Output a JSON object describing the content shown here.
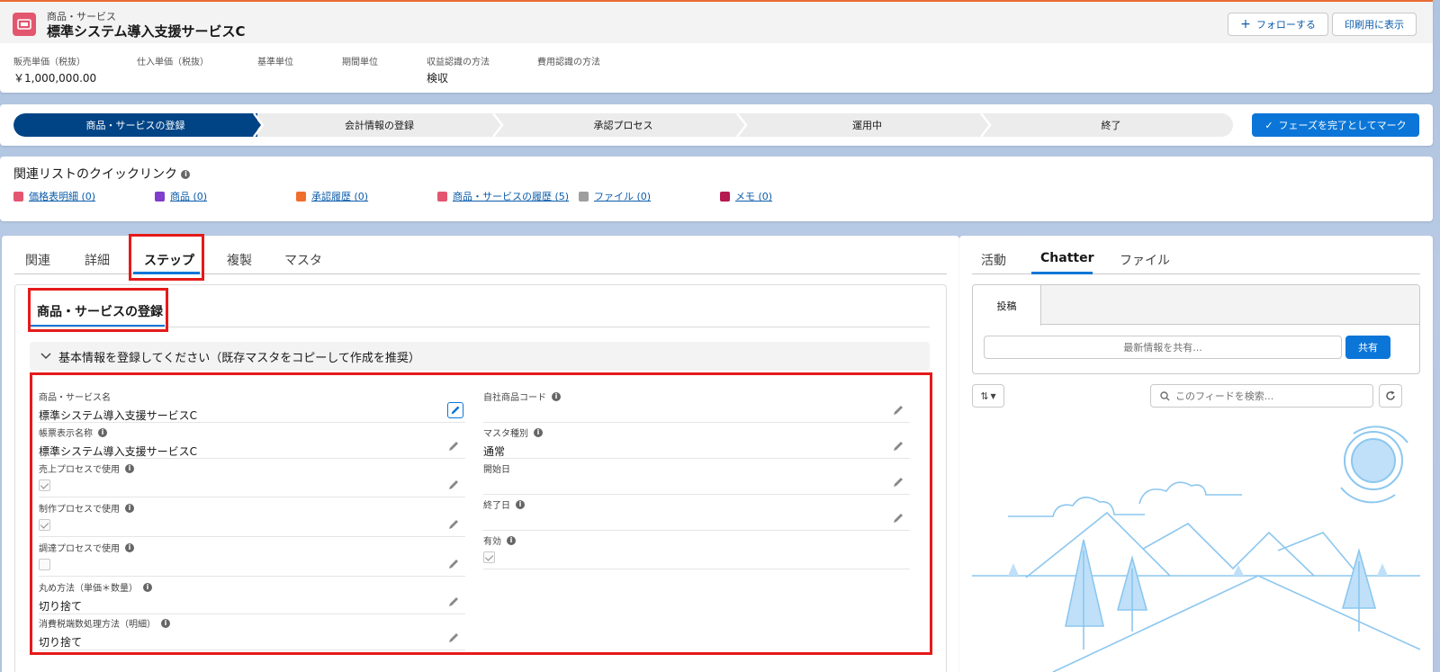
{
  "header": {
    "object_type": "商品・サービス",
    "record_name": "標準システム導入支援サービスC",
    "follow_label": "フォローする",
    "print_label": "印刷用に表示",
    "fields": [
      {
        "label": "販売単価（税抜）",
        "value": "￥1,000,000.00"
      },
      {
        "label": "仕入単価（税抜）",
        "value": ""
      },
      {
        "label": "基準単位",
        "value": ""
      },
      {
        "label": "期間単位",
        "value": ""
      },
      {
        "label": "収益認識の方法",
        "value": "検収"
      },
      {
        "label": "費用認識の方法",
        "value": ""
      }
    ]
  },
  "path": {
    "stages": [
      "商品・サービスの登録",
      "会計情報の登録",
      "承認プロセス",
      "運用中",
      "終了"
    ],
    "active_index": 0,
    "complete_label": "フェーズを完了としてマーク"
  },
  "quick_links": {
    "title": "関連リストのクイックリンク",
    "items": [
      {
        "label": "価格表明細 (0)",
        "color": "#e3566f"
      },
      {
        "label": "商品 (0)",
        "color": "#7f3ecb"
      },
      {
        "label": "承認履歴 (0)",
        "color": "#f06e2c"
      },
      {
        "label": "商品・サービスの履歴 (5)",
        "color": "#e3566f"
      },
      {
        "label": "ファイル (0)",
        "color": "#9e9e9e"
      },
      {
        "label": "メモ (0)",
        "color": "#b5194f"
      }
    ]
  },
  "main_tabs": [
    "関連",
    "詳細",
    "ステップ",
    "複製",
    "マスタ"
  ],
  "step": {
    "subtab": "商品・サービスの登録",
    "section_title": "基本情報を登録してください（既存マスタをコピーして作成を推奨）",
    "left_fields": [
      {
        "label": "商品・サービス名",
        "value": "標準システム導入支援サービスC",
        "type": "text",
        "info": false
      },
      {
        "label": "帳票表示名称",
        "value": "標準システム導入支援サービスC",
        "type": "text",
        "info": true
      },
      {
        "label": "売上プロセスで使用",
        "value": "",
        "type": "checkbox",
        "checked": true,
        "info": true
      },
      {
        "label": "制作プロセスで使用",
        "value": "",
        "type": "checkbox",
        "checked": true,
        "info": true
      },
      {
        "label": "調達プロセスで使用",
        "value": "",
        "type": "checkbox",
        "checked": false,
        "info": true
      },
      {
        "label": "丸め方法（単価＊数量）",
        "value": "切り捨て",
        "type": "text",
        "info": true
      },
      {
        "label": "消費税端数処理方法（明細）",
        "value": "切り捨て",
        "type": "text",
        "info": true
      }
    ],
    "right_fields": [
      {
        "label": "自社商品コード",
        "value": "",
        "type": "text",
        "info": true
      },
      {
        "label": "マスタ種別",
        "value": "通常",
        "type": "text",
        "info": true
      },
      {
        "label": "開始日",
        "value": "",
        "type": "text",
        "info": false
      },
      {
        "label": "終了日",
        "value": "",
        "type": "text",
        "info": true
      },
      {
        "label": "有効",
        "value": "",
        "type": "checkbox",
        "checked": true,
        "info": true
      }
    ]
  },
  "right_panel": {
    "tabs": [
      "活動",
      "Chatter",
      "ファイル"
    ],
    "active_tab": "Chatter",
    "publisher_tab": "投稿",
    "share_placeholder": "最新情報を共有...",
    "share_button": "共有",
    "feed_search_placeholder": "このフィードを検索..."
  },
  "colors": {
    "brand": "#0b76d8",
    "path_active": "#014486",
    "highlight": "#e51a1a",
    "object_icon": "#e3566f"
  }
}
